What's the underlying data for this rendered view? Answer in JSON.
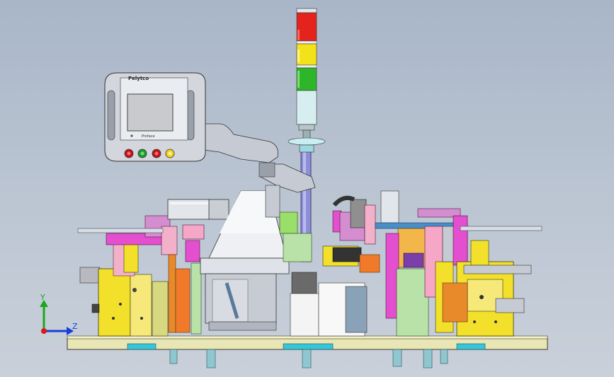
{
  "hmi": {
    "brand": "Pelytco",
    "model": "Proface"
  },
  "axes": {
    "y_label": "Y",
    "z_label": "Z",
    "y_color": "#1aa81a",
    "z_color": "#1a3fd8",
    "x_color": "#d81a1a"
  },
  "signal_tower": {
    "lights": [
      "red",
      "yellow",
      "green"
    ],
    "colors": [
      "#e4231c",
      "#f2e21a",
      "#2fb52a"
    ]
  },
  "buttons": {
    "colors": [
      "#c0141a",
      "#1e9a2c",
      "#c0141a",
      "#f0d21a"
    ]
  }
}
